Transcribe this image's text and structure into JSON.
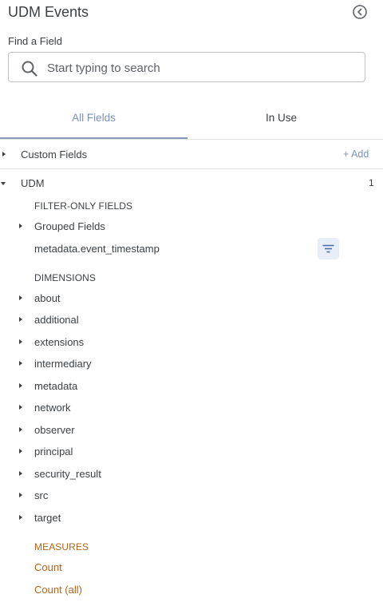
{
  "header": {
    "title": "UDM Events",
    "back_icon": "chevron-left-circle-icon"
  },
  "search": {
    "label": "Find a Field",
    "placeholder": "Start typing to search",
    "value": "",
    "icon": "search-icon"
  },
  "tabs": [
    {
      "label": "All Fields",
      "active": true
    },
    {
      "label": "In Use",
      "active": false
    }
  ],
  "custom_fields": {
    "label": "Custom Fields",
    "add_label": "+ Add"
  },
  "udm": {
    "label": "UDM",
    "count": "1",
    "filter_only": {
      "heading": "FILTER-ONLY FIELDS",
      "grouped_label": "Grouped Fields",
      "timestamp_label": "metadata.event_timestamp",
      "filter_icon": "filter-icon"
    },
    "dimensions": {
      "heading": "DIMENSIONS",
      "items": [
        "about",
        "additional",
        "extensions",
        "intermediary",
        "metadata",
        "network",
        "observer",
        "principal",
        "security_result",
        "src",
        "target"
      ]
    },
    "measures": {
      "heading": "MEASURES",
      "items": [
        "Count",
        "Count (all)"
      ]
    }
  },
  "colors": {
    "accent": "#7d93b8",
    "measure": "#b0671c",
    "text": "#3c4043"
  }
}
